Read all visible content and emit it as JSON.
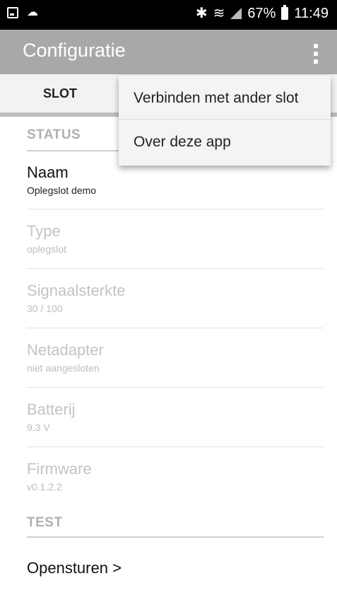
{
  "status_bar": {
    "left_icons": [
      "gallery-icon",
      "cloud-icon"
    ],
    "right_icons": [
      "bluetooth-icon",
      "wifi-icon",
      "signal-icon",
      "battery-icon"
    ],
    "battery": "67%",
    "time": "11:49"
  },
  "app_bar": {
    "title": "Configuratie",
    "menu_icon": "overflow-menu-icon"
  },
  "tabs": [
    {
      "label": "SLOT"
    }
  ],
  "popup_menu": {
    "items": [
      {
        "label": "Verbinden met ander slot"
      },
      {
        "label": "Over deze app"
      }
    ]
  },
  "sections": {
    "status": {
      "header": "STATUS",
      "rows": [
        {
          "title": "Naam",
          "value": "Oplegslot demo"
        },
        {
          "title": "Type",
          "value": "oplegslot"
        },
        {
          "title": "Signaalsterkte",
          "value": "30 / 100"
        },
        {
          "title": "Netadapter",
          "value": "niet aangesloten"
        },
        {
          "title": "Batterij",
          "value": "9.3 V"
        },
        {
          "title": "Firmware",
          "value": "v0.1.2.2"
        }
      ]
    },
    "test": {
      "header": "TEST",
      "action": "Opensturen >"
    }
  },
  "colors": {
    "app_bar": "#a8a8a8",
    "status_bar": "#000000",
    "popup_bg": "#f4f4f4",
    "disabled_text": "#c4c4c4"
  }
}
